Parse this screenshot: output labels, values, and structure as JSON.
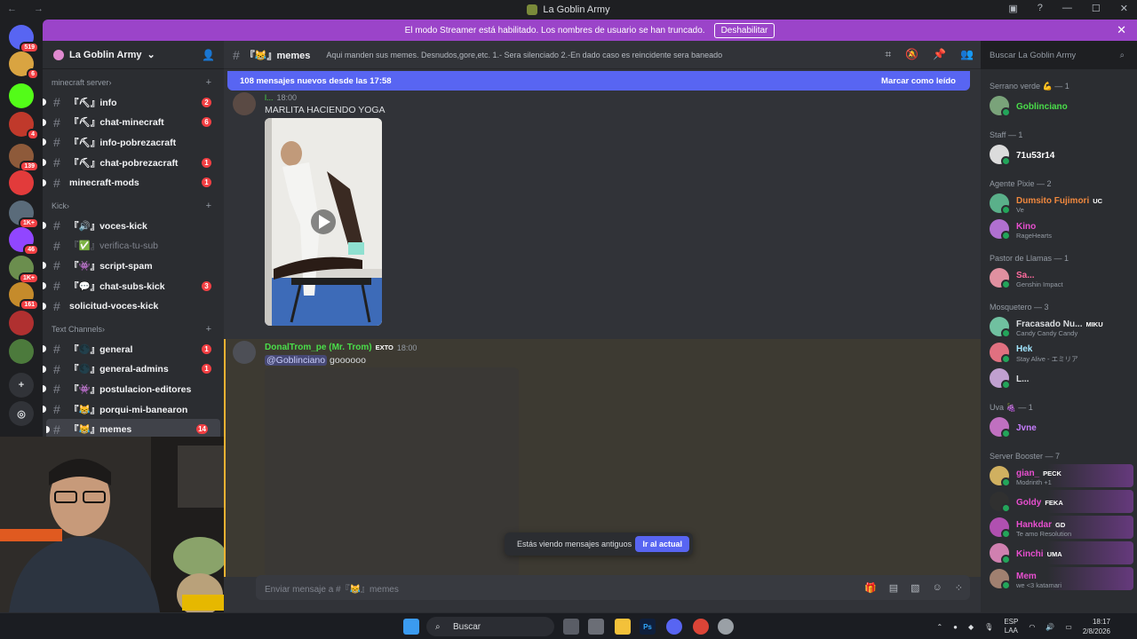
{
  "window": {
    "title": "La Goblin Army"
  },
  "banner": {
    "text": "El modo Streamer está habilitado. Los nombres de usuario se han truncado.",
    "button": "Deshabilitar"
  },
  "server_rail": [
    {
      "badge": "519",
      "color": "#5865f2"
    },
    {
      "badge": "6",
      "color": "#d9a441"
    },
    {
      "badge": "",
      "color": "#53fc18"
    },
    {
      "badge": "4",
      "color": "#c0392b"
    },
    {
      "badge": "139",
      "color": "#8e5a3a"
    },
    {
      "badge": "",
      "color": "#e23b3b"
    },
    {
      "badge": "1K+",
      "color": "#5a6b7a"
    },
    {
      "badge": "46",
      "color": "#9146ff"
    },
    {
      "badge": "1K+",
      "color": "#6b8e4e"
    },
    {
      "badge": "161",
      "color": "#c58b2b"
    },
    {
      "badge": "",
      "color": "#b03030"
    },
    {
      "badge": "",
      "color": "#4c7a3c"
    }
  ],
  "sidebar": {
    "server_name": "La Goblin Army",
    "categories": [
      {
        "name": "minecraft server",
        "channels": [
          {
            "name": "『⛏』info",
            "count": "2",
            "muted": false
          },
          {
            "name": "『⛏』chat-minecraft",
            "count": "6",
            "muted": false
          },
          {
            "name": "『⛏』info-pobrezacraft",
            "count": "",
            "muted": false
          },
          {
            "name": "『⛏』chat-pobrezacraft",
            "count": "1",
            "muted": false
          },
          {
            "name": "minecraft-mods",
            "count": "1",
            "muted": false
          }
        ]
      },
      {
        "name": "Kick",
        "channels": [
          {
            "name": "『🔊』voces-kick",
            "count": "",
            "muted": false
          },
          {
            "name": "『✅』verifica-tu-sub",
            "count": "",
            "muted": true
          },
          {
            "name": "『👾』script-spam",
            "count": "",
            "muted": false
          },
          {
            "name": "『💬』chat-subs-kick",
            "count": "3",
            "muted": false
          },
          {
            "name": "solicitud-voces-kick",
            "count": "",
            "muted": false
          }
        ]
      },
      {
        "name": "Text Channels",
        "channels": [
          {
            "name": "『🌑』general",
            "count": "1",
            "muted": false
          },
          {
            "name": "『🌑』general-admins",
            "count": "1",
            "muted": false
          },
          {
            "name": "『👾』postulacion-editores",
            "count": "",
            "muted": false
          },
          {
            "name": "『😹』porqui-mi-banearon",
            "count": "",
            "muted": false
          },
          {
            "name": "『😹』memes",
            "count": "14",
            "muted": false,
            "active": true
          }
        ]
      }
    ]
  },
  "chat_header": {
    "channel": "『😹』memes",
    "topic": "Aqui manden sus memes. Desnudos,gore,etc. 1.- Sera silenciado 2.-En dado caso es reincidente sera baneado"
  },
  "search": {
    "placeholder": "Buscar La Goblin Army"
  },
  "new_messages": {
    "text": "108 mensajes nuevos desde las 17:58",
    "action": "Marcar como leído"
  },
  "messages": [
    {
      "author": "l...",
      "time": "18:00",
      "text": "MARLITA HACIENDO YOGA"
    },
    {
      "author": "DonalTrom_pe (Mr. Trom)",
      "badge": "EXTO",
      "time": "18:00",
      "mention": "@Goblinciano",
      "text": " goooooo"
    }
  ],
  "old_messages_bar": {
    "text": "Estás viendo mensajes antiguos",
    "button": "Ir al actual"
  },
  "composer": {
    "placeholder": "Enviar mensaje a #『😹』memes"
  },
  "members": [
    {
      "role": "Serrano verde 💪 — 1",
      "users": [
        {
          "name": "Goblinciano",
          "status": "",
          "color": "#4ade4a"
        }
      ]
    },
    {
      "role": "Staff — 1",
      "users": [
        {
          "name": "71u53r14",
          "status": "",
          "color": "#ffffff"
        }
      ]
    },
    {
      "role": "Agente Pixie — 2",
      "users": [
        {
          "name": "Dumsito Fujimori",
          "status": "Ve",
          "color": "#f0883e",
          "tag": "UC"
        },
        {
          "name": "Kino",
          "status": "RageHearts",
          "color": "#e84fd0"
        }
      ]
    },
    {
      "role": "Pastor de Llamas — 1",
      "users": [
        {
          "name": "Sa...",
          "status": "Genshin Impact",
          "color": "#ff6b9e"
        }
      ]
    },
    {
      "role": "Mosquetero — 3",
      "users": [
        {
          "name": "Fracasado Nu...",
          "status": "Candy Candy Candy",
          "color": "#dbdee1",
          "tag": "MIKU"
        },
        {
          "name": "Hek",
          "status": "Stay Alive - エミリア",
          "color": "#a3e7ff"
        },
        {
          "name": "L...",
          "status": "",
          "color": "#dbdee1"
        }
      ]
    },
    {
      "role": "Uva 🍇 — 1",
      "users": [
        {
          "name": "Jvne",
          "status": "",
          "color": "#c77dff"
        }
      ]
    },
    {
      "role": "Server Booster — 7",
      "users": [
        {
          "name": "gian_",
          "status": "Modrinth +1",
          "color": "#e84fd0",
          "tag": "PECK"
        },
        {
          "name": "Goldy",
          "status": "",
          "color": "#e84fd0",
          "tag": "FEKA"
        },
        {
          "name": "Hankdar",
          "status": "Te amo Resolution",
          "color": "#e84fd0",
          "tag": "GD"
        },
        {
          "name": "Kinchi",
          "status": "",
          "color": "#e84fd0",
          "tag": "UMA"
        },
        {
          "name": "Mem",
          "status": "we <3 katamari",
          "color": "#e84fd0"
        }
      ]
    }
  ],
  "taskbar": {
    "search": "Buscar",
    "lang": "ESP",
    "lang2": "LAA",
    "time": "18:17",
    "date": "2/8/2026"
  }
}
